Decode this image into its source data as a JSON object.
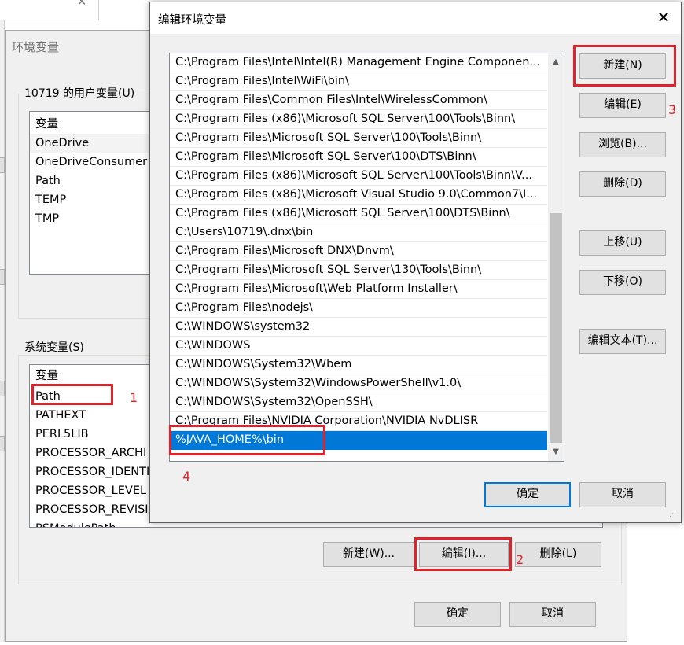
{
  "env_window": {
    "title": "环境变量",
    "user_group_label": "10719 的用户变量(U)",
    "user_list_header": "变量",
    "user_vars": [
      "OneDrive",
      "OneDriveConsumer",
      "Path",
      "TEMP",
      "TMP"
    ],
    "system_group_label": "系统变量(S)",
    "system_list_header": "变量",
    "system_vars": [
      "Path",
      "PATHEXT",
      "PERL5LIB",
      "PROCESSOR_ARCHI",
      "PROCESSOR_IDENTI",
      "PROCESSOR_LEVEL",
      "PROCESSOR_REVISIO",
      "PSModulePath"
    ],
    "buttons": {
      "new": "新建(W)...",
      "edit": "编辑(I)...",
      "delete": "删除(L)",
      "ok": "确定",
      "cancel": "取消"
    }
  },
  "edit_dialog": {
    "title": "编辑环境变量",
    "close_glyph": "✕",
    "paths": [
      "C:\\Program Files\\Intel\\Intel(R) Management Engine Componen...",
      "C:\\Program Files\\Intel\\WiFi\\bin\\",
      "C:\\Program Files\\Common Files\\Intel\\WirelessCommon\\",
      "C:\\Program Files (x86)\\Microsoft SQL Server\\100\\Tools\\Binn\\",
      "C:\\Program Files\\Microsoft SQL Server\\100\\Tools\\Binn\\",
      "C:\\Program Files\\Microsoft SQL Server\\100\\DTS\\Binn\\",
      "C:\\Program Files (x86)\\Microsoft SQL Server\\100\\Tools\\Binn\\V...",
      "C:\\Program Files (x86)\\Microsoft Visual Studio 9.0\\Common7\\I...",
      "C:\\Program Files (x86)\\Microsoft SQL Server\\100\\DTS\\Binn\\",
      "C:\\Users\\10719\\.dnx\\bin",
      "C:\\Program Files\\Microsoft DNX\\Dnvm\\",
      "C:\\Program Files\\Microsoft SQL Server\\130\\Tools\\Binn\\",
      "C:\\Program Files\\Microsoft\\Web Platform Installer\\",
      "C:\\Program Files\\nodejs\\",
      "C:\\WINDOWS\\system32",
      "C:\\WINDOWS",
      "C:\\WINDOWS\\System32\\Wbem",
      "C:\\WINDOWS\\System32\\WindowsPowerShell\\v1.0\\",
      "C:\\WINDOWS\\System32\\OpenSSH\\",
      "C:\\Program Files\\NVIDIA Corporation\\NVIDIA NvDLISR",
      "%JAVA_HOME%\\bin"
    ],
    "selected_index": 20,
    "buttons": {
      "new": "新建(N)",
      "edit": "编辑(E)",
      "browse": "浏览(B)...",
      "delete": "删除(D)",
      "move_up": "上移(U)",
      "move_down": "下移(O)",
      "edit_text": "编辑文本(T)...",
      "ok": "确定",
      "cancel": "取消"
    }
  },
  "annotations": {
    "step1": "1",
    "step2": "2",
    "step3": "3",
    "step4": "4"
  },
  "colors": {
    "highlight": "#0078d7",
    "annotation_red": "#e2222b",
    "dialog_bg": "#f0f0f0"
  }
}
